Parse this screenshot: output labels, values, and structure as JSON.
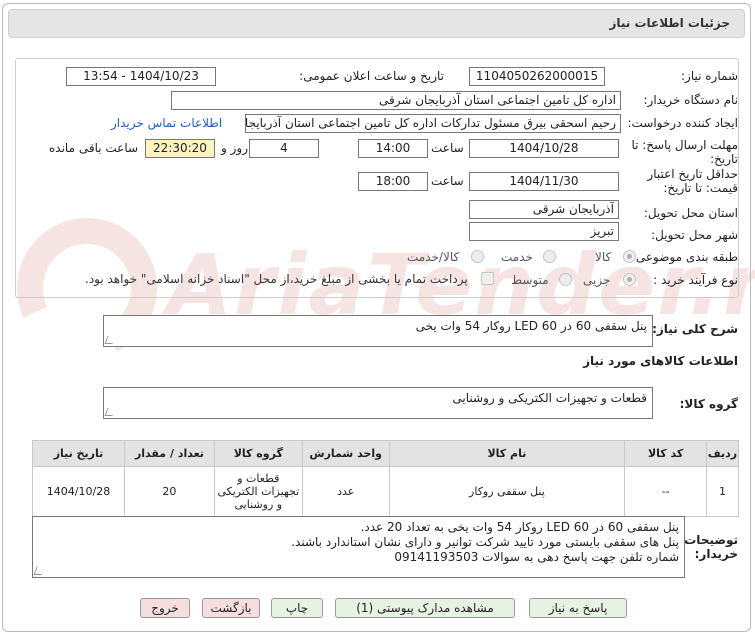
{
  "title": "جزئیات اطلاعات نیاز",
  "fields": {
    "need_number_label": "شماره نیاز:",
    "need_number": "1104050262000015",
    "announce_label": "تاریخ و ساعت اعلان عمومی:",
    "announce_value": "1404/10/23 - 13:54",
    "buyer_label": "نام دستگاه خریدار:",
    "buyer_value": "اداره کل تامین اجتماعی استان آذربایجان شرقی",
    "creator_label": "ایجاد کننده درخواست:",
    "creator_value": "رحیم اسحقی بیرق مسئول تدارکات اداره کل تامین اجتماعی استان آذربایجان شرقی",
    "contact_link": "اطلاعات تماس خریدار",
    "deadline_label_1": "مهلت ارسال پاسخ: تا",
    "deadline_label_2": "تاریخ:",
    "deadline_date": "1404/10/28",
    "time_label": "ساعت",
    "deadline_time": "14:00",
    "days_value": "4",
    "days_label": "روز و",
    "remaining_time": "22:30:20",
    "remaining_label": "ساعت باقی مانده",
    "validity_label_1": "حداقل تاریخ اعتبار",
    "validity_label_2": "قیمت: تا تاریخ:",
    "validity_date": "1404/11/30",
    "validity_time_label": "ساعت",
    "validity_time": "18:00",
    "province_label": "استان محل تحویل:",
    "province_value": "آذربایجان شرقی",
    "city_label": "شهر محل تحویل:",
    "city_value": "تبریز",
    "category_label": "طبقه بندی موضوعی:",
    "category_options": [
      "کالا",
      "خدمت",
      "کالا/خدمت"
    ],
    "purchase_label": "نوع فرآیند خرید :",
    "purchase_options": [
      "جزیی",
      "متوسط"
    ],
    "payment_note": "پرداخت تمام یا بخشی از مبلغ خرید،از محل \"اسناد خزانه اسلامی\" خواهد بود."
  },
  "need_desc_label": "شرح کلی نیاز:",
  "need_desc": "پنل سقفی 60 در 60 LED روکار 54 وات یخی",
  "goods_info_title": "اطلاعات کالاهای مورد نیاز",
  "goods_group_label": "گروه کالا:",
  "goods_group_value": "قطعات و تجهیزات الکتریکی و روشنایی",
  "table": {
    "headers": [
      "ردیف",
      "کد کالا",
      "نام کالا",
      "واحد شمارش",
      "گروه کالا",
      "تعداد / مقدار",
      "تاریخ نیاز"
    ],
    "rows": [
      [
        "1",
        "--",
        "پنل سقفی روکار",
        "عدد",
        "قطعات و تجهیزات الکتریکی و روشنایی",
        "20",
        "1404/10/28"
      ]
    ]
  },
  "buyer_notes_label_1": "توضیحات",
  "buyer_notes_label_2": "خریدار:",
  "buyer_notes": [
    "پنل سقفی 60 در 60 LED روکار 54 وات یخی به تعداد 20 عدد.",
    "پنل های سقفی بایستی مورد تایید شرکت توانیر و دارای نشان استاندارد باشند.",
    "شماره تلفن جهت پاسخ دهی به سوالات 09141193503"
  ],
  "buttons": {
    "reply": "پاسخ به نیاز",
    "view_docs": "مشاهده مدارک پیوستی (1)",
    "print": "چاپ",
    "back": "بازگشت",
    "exit": "خروج"
  },
  "watermark": "AriaTender.net"
}
